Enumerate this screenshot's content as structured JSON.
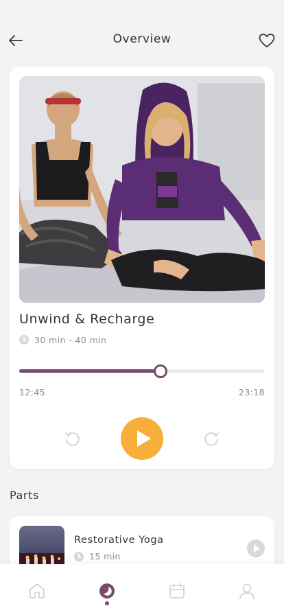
{
  "header": {
    "title": "Overview",
    "back_icon": "arrow-left-icon",
    "favorite_icon": "heart-outline-icon"
  },
  "session": {
    "title": "Unwind & Recharge",
    "duration": "30 min - 40 min",
    "image": "two women meditating in lotus pose on yoga mat"
  },
  "player": {
    "progress": 0.575,
    "elapsed": "12:45",
    "total": "23:18",
    "icons": {
      "rewind": "rotate-left-icon",
      "play": "play-icon",
      "forward": "rotate-right-icon"
    }
  },
  "parts": {
    "label": "Parts",
    "items": [
      {
        "title": "Restorative Yoga",
        "duration": "15 min"
      }
    ]
  },
  "tabbar": {
    "items": [
      {
        "name": "home",
        "icon": "home-icon",
        "active": false
      },
      {
        "name": "meditate",
        "icon": "moon-icon",
        "active": true
      },
      {
        "name": "calendar",
        "icon": "calendar-icon",
        "active": false
      },
      {
        "name": "profile",
        "icon": "user-icon",
        "active": false
      }
    ]
  },
  "colors": {
    "accent": "#7a4a6c",
    "play_button": "#f7ae3b",
    "background": "#f3f3f5"
  }
}
